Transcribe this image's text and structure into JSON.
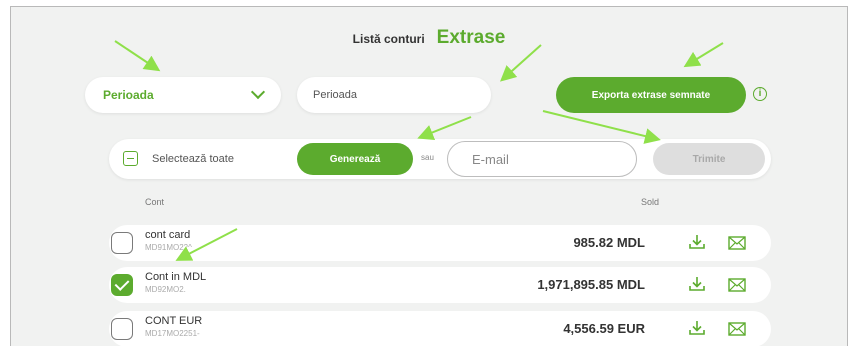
{
  "tabs": {
    "list_accounts": "Listă conturi",
    "statements": "Extrase"
  },
  "filters": {
    "period_select_label": "Perioada",
    "period_input_value": "Perioada",
    "export_button": "Exporta extrase semnate",
    "info_icon": "i"
  },
  "actions": {
    "select_all": "Selectează toate",
    "generate_button": "Generează",
    "or_label": "sau",
    "email_placeholder": "E-mail",
    "send_button": "Trimite"
  },
  "table": {
    "col_account": "Cont",
    "col_balance": "Sold",
    "rows": [
      {
        "name": "cont card",
        "iban": "MD91MO22^",
        "balance": "985.82 MDL",
        "checked": false
      },
      {
        "name": "Cont in MDL",
        "iban": "MD92MO2.",
        "balance": "1,971,895.85 MDL",
        "checked": true
      },
      {
        "name": "CONT EUR",
        "iban": "MD17MO2251-",
        "balance": "4,556.59 EUR",
        "checked": false
      }
    ]
  },
  "icons": {
    "download": "download-icon",
    "email": "envelope-icon",
    "dropdown": "chevron-down-icon",
    "checkbox_minus": "minus-checkbox-icon"
  },
  "colors": {
    "accent": "#5cab2e",
    "annotation_arrow": "#8fe04a",
    "disabled": "#dedede",
    "background": "#f1f2f1"
  }
}
